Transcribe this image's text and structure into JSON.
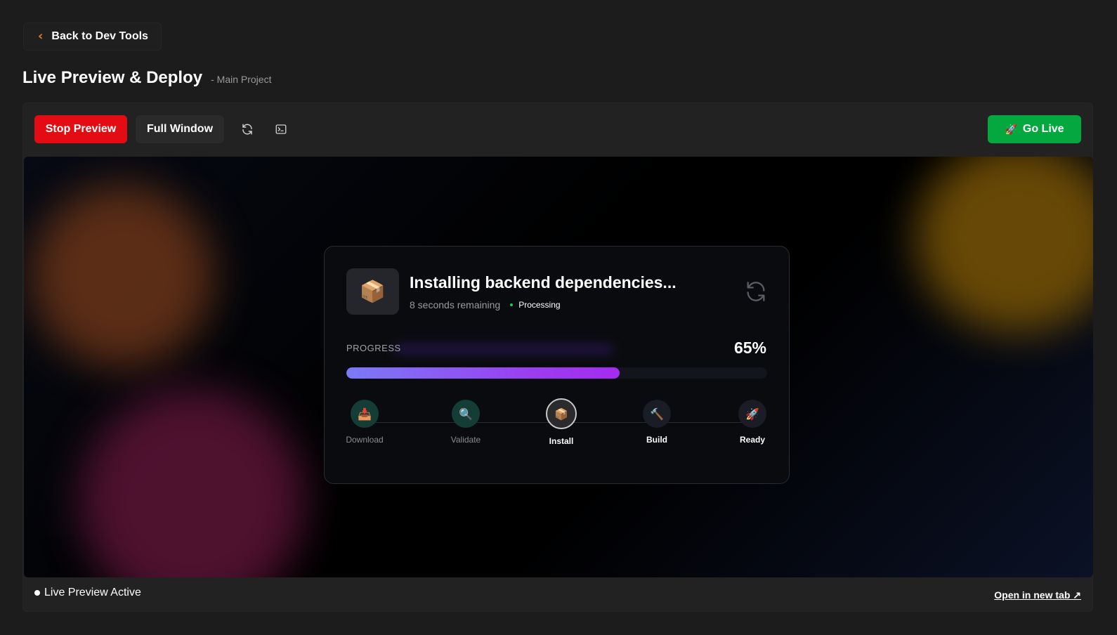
{
  "nav": {
    "back_label": "Back to Dev Tools"
  },
  "header": {
    "title": "Live Preview & Deploy",
    "subtitle": "- Main Project"
  },
  "toolbar": {
    "stop_label": "Stop Preview",
    "full_window_label": "Full Window",
    "go_live_label": "Go Live",
    "go_live_icon": "🚀"
  },
  "card": {
    "icon": "📦",
    "title": "Installing backend dependencies...",
    "remaining": "8 seconds remaining",
    "status": "Processing",
    "progress_label": "PROGRESS",
    "progress_text": "65%",
    "progress_value": 0.65,
    "steps": [
      {
        "icon": "📥",
        "label": "Download",
        "state": "done"
      },
      {
        "icon": "🔍",
        "label": "Validate",
        "state": "done"
      },
      {
        "icon": "📦",
        "label": "Install",
        "state": "active"
      },
      {
        "icon": "🔨",
        "label": "Build",
        "state": "pending"
      },
      {
        "icon": "🚀",
        "label": "Ready",
        "state": "pending"
      }
    ]
  },
  "footer": {
    "live_status": "Live Preview Active",
    "open_link": "Open in new tab ↗"
  },
  "colors": {
    "stop": "#e30c12",
    "go_live": "#05a73f",
    "accent_chevron": "#e07a2a",
    "progress_start": "#7a7bf6",
    "progress_end": "#a52bf0"
  }
}
